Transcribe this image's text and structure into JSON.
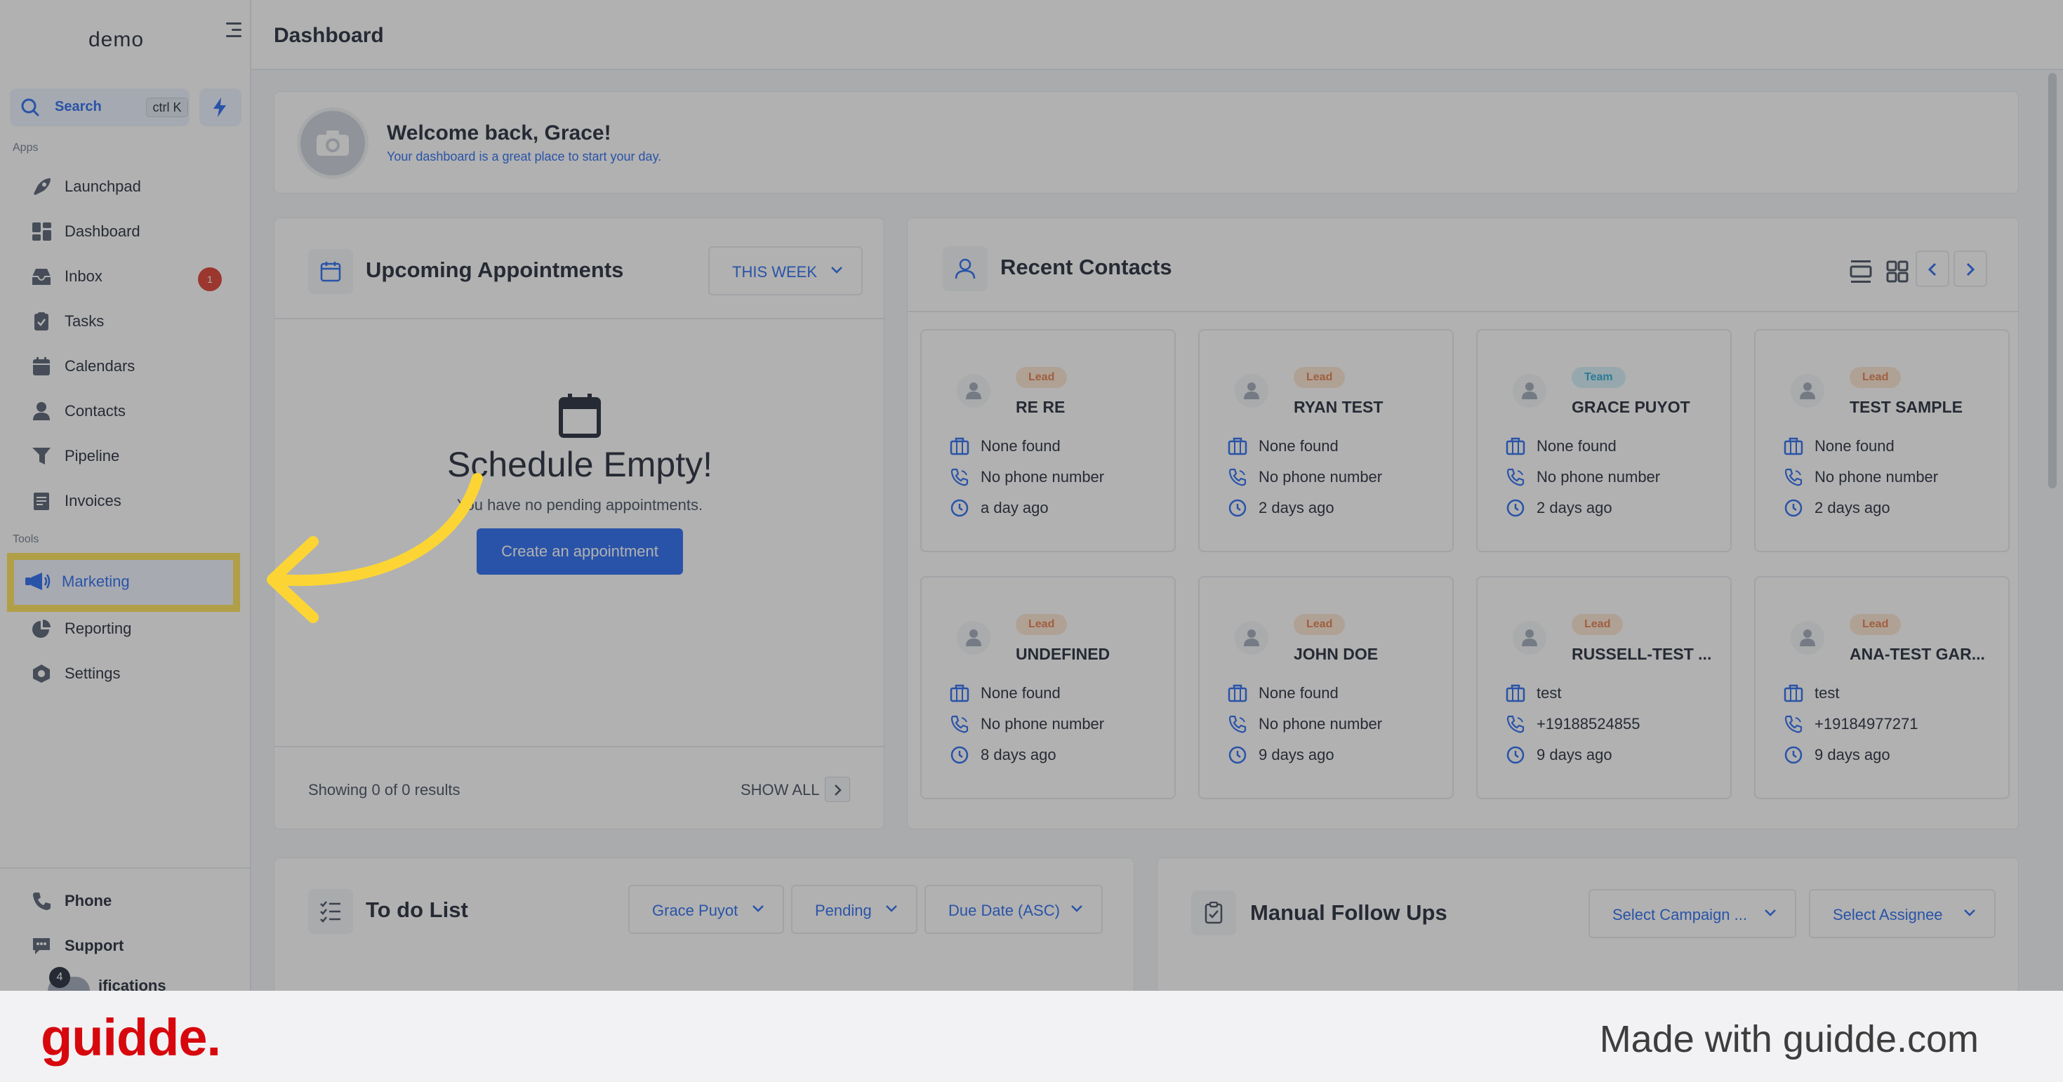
{
  "app": {
    "logo": "demo",
    "page_title": "Dashboard"
  },
  "search": {
    "label": "Search",
    "shortcut": "ctrl K"
  },
  "sidebar": {
    "apps_label": "Apps",
    "tools_label": "Tools",
    "apps": [
      {
        "label": "Launchpad",
        "icon": "rocket-icon"
      },
      {
        "label": "Dashboard",
        "icon": "dashboard-icon"
      },
      {
        "label": "Inbox",
        "icon": "inbox-icon",
        "badge": "1"
      },
      {
        "label": "Tasks",
        "icon": "tasks-icon"
      },
      {
        "label": "Calendars",
        "icon": "calendar-icon"
      },
      {
        "label": "Contacts",
        "icon": "contact-icon"
      },
      {
        "label": "Pipeline",
        "icon": "pipeline-icon"
      },
      {
        "label": "Invoices",
        "icon": "invoice-icon"
      }
    ],
    "tools": [
      {
        "label": "Marketing",
        "icon": "megaphone-icon",
        "active": true
      },
      {
        "label": "Reporting",
        "icon": "chart-pie-icon"
      },
      {
        "label": "Settings",
        "icon": "gear-icon"
      }
    ],
    "bottom": [
      {
        "label": "Phone",
        "icon": "phone-icon"
      },
      {
        "label": "Support",
        "icon": "support-icon"
      },
      {
        "label": "ifications",
        "icon": "bell-icon",
        "badge": "4"
      }
    ]
  },
  "welcome": {
    "title": "Welcome back, Grace!",
    "subtitle": "Your dashboard is a great place to start your day."
  },
  "appointments": {
    "title": "Upcoming Appointments",
    "filter": "THIS WEEK",
    "empty_title": "Schedule Empty!",
    "empty_sub": "You have no pending appointments.",
    "create_button": "Create an appointment",
    "showing": "Showing 0 of 0 results",
    "show_all": "SHOW ALL"
  },
  "contacts": {
    "title": "Recent Contacts",
    "items": [
      {
        "tag": "Lead",
        "name": "RE RE",
        "company": "None found",
        "phone": "No phone number",
        "time": "a day ago"
      },
      {
        "tag": "Lead",
        "name": "RYAN TEST",
        "company": "None found",
        "phone": "No phone number",
        "time": "2 days ago"
      },
      {
        "tag": "Team",
        "name": "GRACE PUYOT",
        "company": "None found",
        "phone": "No phone number",
        "time": "2 days ago"
      },
      {
        "tag": "Lead",
        "name": "TEST SAMPLE",
        "company": "None found",
        "phone": "No phone number",
        "time": "2 days ago"
      },
      {
        "tag": "Lead",
        "name": "UNDEFINED",
        "company": "None found",
        "phone": "No phone number",
        "time": "8 days ago"
      },
      {
        "tag": "Lead",
        "name": "JOHN DOE",
        "company": "None found",
        "phone": "No phone number",
        "time": "9 days ago"
      },
      {
        "tag": "Lead",
        "name": "RUSSELL-TEST ...",
        "company": "test",
        "phone": "+19188524855",
        "time": "9 days ago"
      },
      {
        "tag": "Lead",
        "name": "ANA-TEST GAR...",
        "company": "test",
        "phone": "+19184977271",
        "time": "9 days ago"
      }
    ]
  },
  "todo": {
    "title": "To do List",
    "assignee": "Grace Puyot",
    "status": "Pending",
    "sort": "Due Date (ASC)"
  },
  "followups": {
    "title": "Manual Follow Ups",
    "campaign": "Select Campaign ...",
    "assignee": "Select Assignee"
  },
  "footer": {
    "brand": "guidde.",
    "made_with": "Made with guidde.com"
  },
  "colors": {
    "accent": "#155eef",
    "highlight": "#fde047",
    "brand": "#d7080d"
  }
}
